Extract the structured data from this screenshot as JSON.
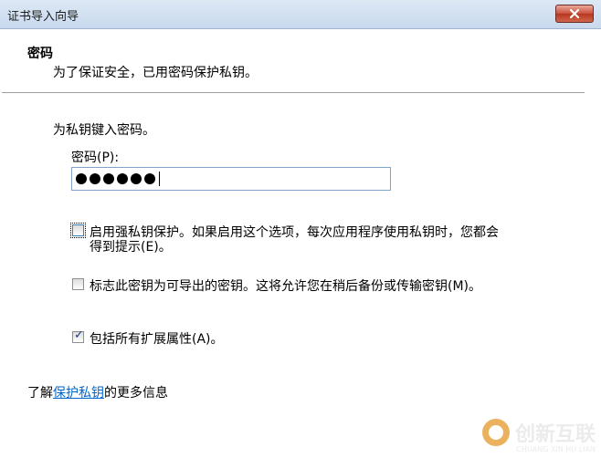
{
  "window": {
    "title": "证书导入向导"
  },
  "header": {
    "title": "密码",
    "subtitle": "为了保证安全，已用密码保护私钥。"
  },
  "form": {
    "instruction": "为私钥键入密码。",
    "password_label": "密码(P):",
    "password_masked_length": 6
  },
  "options": [
    {
      "line1": "启用强私钥保护。如果启用这个选项，每次应用程序使用私钥时，您都会",
      "line2": "得到提示(E)。",
      "checked": false
    },
    {
      "label": "标志此密钥为可导出的密钥。这将允许您在稍后备份或传输密钥(M)。",
      "checked": false
    },
    {
      "label": "包括所有扩展属性(A)。",
      "checked": true
    }
  ],
  "footer": {
    "learn_prefix": "了解",
    "learn_link": "保护私钥",
    "learn_suffix": "的更多信息"
  },
  "watermark": {
    "brand": "创新互联",
    "sub": "CHUANG XIN HU LIAN"
  },
  "colors": {
    "titlebar": "#c8d9ee",
    "close_button": "#c8503c",
    "link": "#0066cc"
  }
}
